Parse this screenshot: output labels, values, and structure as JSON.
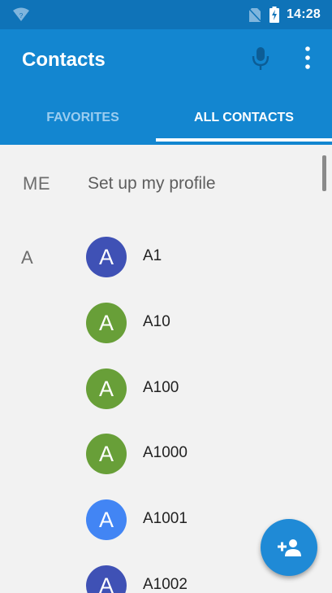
{
  "status_bar": {
    "time": "14:28"
  },
  "app_bar": {
    "title": "Contacts"
  },
  "tabs": [
    {
      "label": "FAVORITES",
      "selected": false
    },
    {
      "label": "ALL CONTACTS",
      "selected": true
    }
  ],
  "me": {
    "label": "ME",
    "text": "Set up my profile"
  },
  "sections": [
    {
      "letter": "A"
    }
  ],
  "contacts": [
    {
      "initial": "A",
      "name": "A1",
      "color": "#3f51b5"
    },
    {
      "initial": "A",
      "name": "A10",
      "color": "#689f38"
    },
    {
      "initial": "A",
      "name": "A100",
      "color": "#689f38"
    },
    {
      "initial": "A",
      "name": "A1000",
      "color": "#689f38"
    },
    {
      "initial": "A",
      "name": "A1001",
      "color": "#4285f4"
    },
    {
      "initial": "A",
      "name": "A1002",
      "color": "#3f51b5"
    }
  ],
  "icons": {
    "status": [
      "wifi-icon",
      "no-sim-icon",
      "battery-charging-icon"
    ],
    "app_bar": [
      "mic-icon",
      "more-vert-icon"
    ],
    "fab": "add-contact-icon"
  }
}
